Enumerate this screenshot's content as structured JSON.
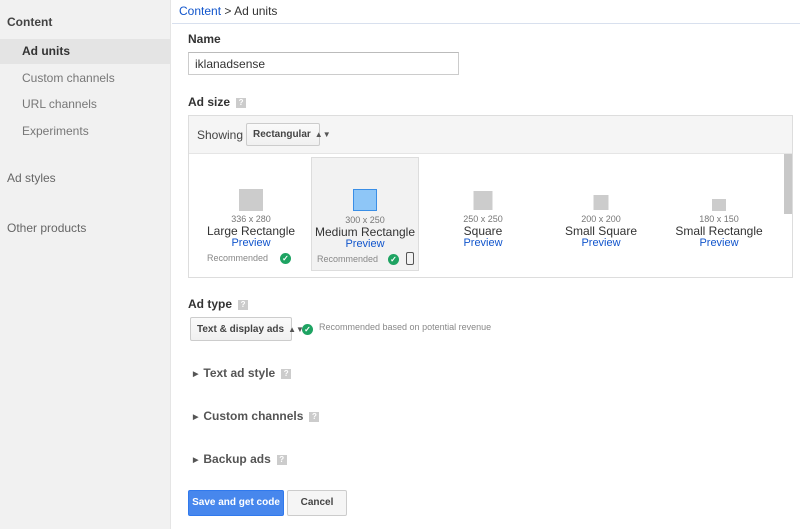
{
  "sidebar": {
    "section_content": "Content",
    "items": [
      "Ad units",
      "Custom channels",
      "URL channels",
      "Experiments"
    ],
    "ad_styles": "Ad styles",
    "other_products": "Other products"
  },
  "breadcrumb": {
    "root": "Content",
    "separator": ">",
    "current": "Ad units"
  },
  "form": {
    "name_label": "Name",
    "name_value": "iklanadsense",
    "ad_size_label": "Ad size",
    "help_glyph": "?",
    "showing_label": "Showing",
    "showing_value": "Rectangular",
    "sizes": [
      {
        "dims": "336 x 280",
        "name": "Large Rectangle",
        "preview": "Preview",
        "recommended": "Recommended"
      },
      {
        "dims": "300 x 250",
        "name": "Medium Rectangle",
        "preview": "Preview",
        "recommended": "Recommended"
      },
      {
        "dims": "250 x 250",
        "name": "Square",
        "preview": "Preview"
      },
      {
        "dims": "200 x 200",
        "name": "Small Square",
        "preview": "Preview"
      },
      {
        "dims": "180 x 150",
        "name": "Small Rectangle",
        "preview": "Preview"
      }
    ],
    "ad_type_label": "Ad type",
    "ad_type_value": "Text & display ads",
    "ad_type_note": "Recommended based on potential revenue",
    "sections": [
      "Text ad style",
      "Custom channels",
      "Backup ads"
    ],
    "save_label": "Save and get code",
    "cancel_label": "Cancel"
  },
  "colors": {
    "primary": "#4787ed",
    "link": "#1155cc",
    "check": "#1ea362",
    "selected_thumb": "#8ec6f7"
  }
}
